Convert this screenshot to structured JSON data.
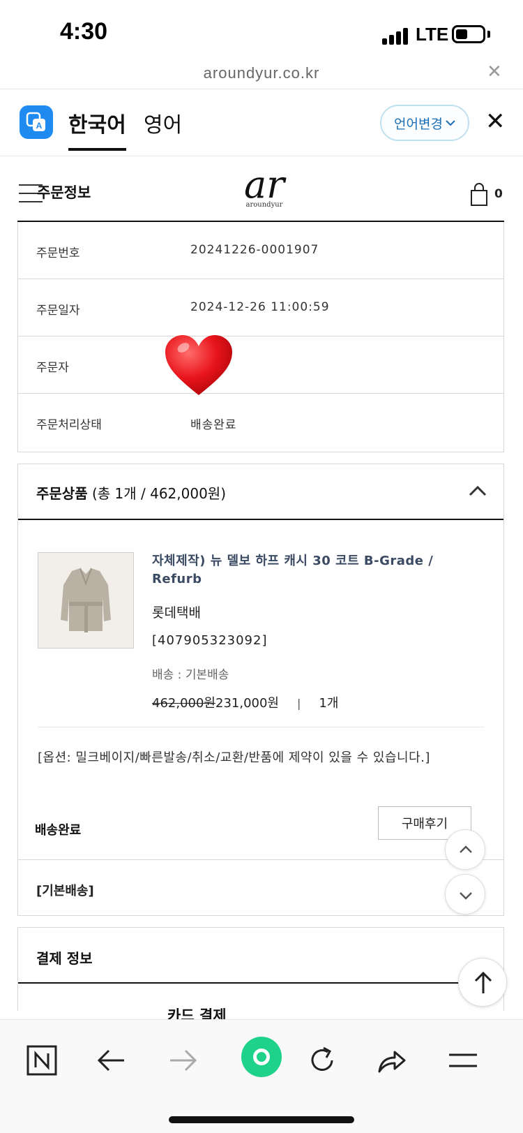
{
  "status_bar": {
    "time": "4:30",
    "network": "LTE"
  },
  "browser": {
    "url": "aroundyur.co.kr"
  },
  "translate_bar": {
    "tabs": [
      "한국어",
      "영어"
    ],
    "change_language": "언어변경"
  },
  "site_header": {
    "title": "주문정보",
    "brand_sub": "aroundyur",
    "cart_count": "0"
  },
  "order_info": [
    {
      "label": "주문번호",
      "value": "20241226-0001907"
    },
    {
      "label": "주문일자",
      "value": "2024-12-26 11:00:59"
    },
    {
      "label": "주문자",
      "value": ""
    },
    {
      "label": "주문처리상태",
      "value": "배송완료"
    }
  ],
  "order_products": {
    "title": "주문상품",
    "summary": "(총 1개 / 462,000원)",
    "item": {
      "name": "자체제작) 뉴 델보 하프 캐시 30 코트 B-Grade / Refurb",
      "courier": "롯데택배",
      "tracking": "[407905323092]",
      "shipping": "배송 : 기본배송",
      "original_price": "462,000원",
      "sale_price": "231,000원",
      "separator": "|",
      "quantity": "1개"
    },
    "option": "[옵션: 밀크베이지/빠른발송/취소/교환/반품에 제약이 있을 수 있습니다.]",
    "status": "배송완료",
    "review_button": "구매후기",
    "shipping_group": "[기본배송]"
  },
  "payment": {
    "title": "결제 정보",
    "method": "카드 결제"
  },
  "colors": {
    "accent_blue": "#1f8bf0",
    "green": "#1fd28a",
    "product_name": "#3b4a63"
  }
}
